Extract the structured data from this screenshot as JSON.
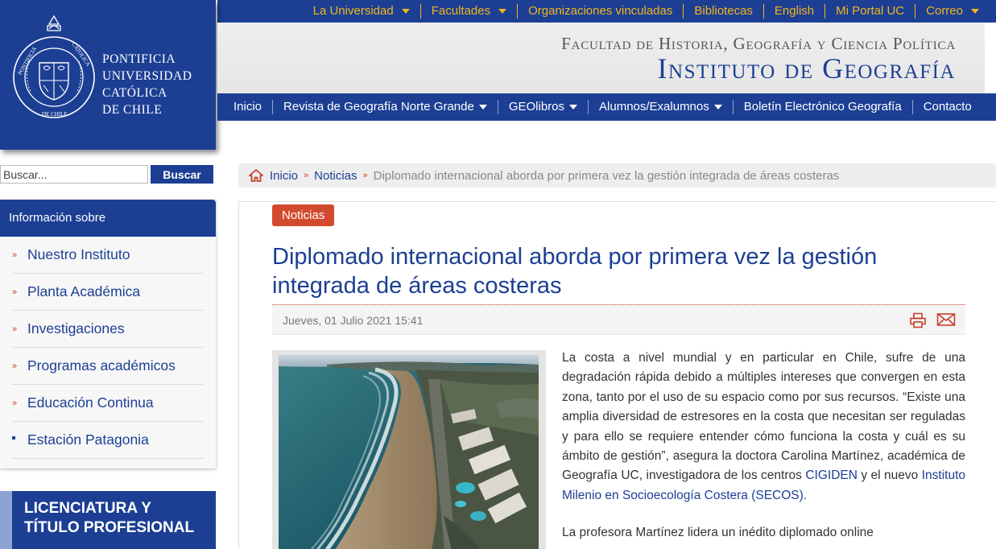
{
  "top_nav": [
    {
      "label": "La Universidad",
      "dropdown": true
    },
    {
      "label": "Facultades",
      "dropdown": true
    },
    {
      "label": "Organizaciones vinculadas",
      "dropdown": false
    },
    {
      "label": "Bibliotecas",
      "dropdown": false
    },
    {
      "label": "English",
      "dropdown": false
    },
    {
      "label": "Mi Portal UC",
      "dropdown": false
    },
    {
      "label": "Correo",
      "dropdown": true
    }
  ],
  "logo": {
    "line1": "PONTIFICIA",
    "line2": "UNIVERSIDAD",
    "line3": "CATÓLICA",
    "line4": "DE CHILE",
    "seal_ring_text": "PONTIFICIA UNIVERSIDAD CATÓLICA DE CHILE"
  },
  "banner": {
    "subtitle": "Facultad de Historia, Geografía y Ciencia Política",
    "title": "Instituto de Geografía"
  },
  "main_nav": [
    {
      "label": "Inicio",
      "dropdown": false
    },
    {
      "label": "Revista de Geografía Norte Grande",
      "dropdown": true
    },
    {
      "label": "GEOlibros",
      "dropdown": true
    },
    {
      "label": "Alumnos/Exalumnos",
      "dropdown": true
    },
    {
      "label": "Boletín Electrónico Geografía",
      "dropdown": false
    },
    {
      "label": "Contacto",
      "dropdown": false
    }
  ],
  "search": {
    "placeholder": "Buscar...",
    "button": "Buscar"
  },
  "sidebar": {
    "heading": "Información sobre",
    "items": [
      {
        "label": "Nuestro Instituto",
        "marker": "»"
      },
      {
        "label": "Planta Académica",
        "marker": "»"
      },
      {
        "label": "Investigaciones",
        "marker": "»"
      },
      {
        "label": "Programas académicos",
        "marker": "»"
      },
      {
        "label": "Educación Continua",
        "marker": "»"
      },
      {
        "label": "Estación Patagonia",
        "marker": "square"
      }
    ]
  },
  "promo": {
    "line1": "LICENCIATURA Y",
    "line2": "TÍTULO PROFESIONAL"
  },
  "breadcrumb": {
    "home": "Inicio",
    "section": "Noticias",
    "separator": "»",
    "current": "Diplomado internacional aborda por primera vez la gestión integrada de áreas costeras"
  },
  "article": {
    "category": "Noticias",
    "title": "Diplomado internacional aborda por primera vez la gestión integrada de áreas costeras",
    "date": "Jueves, 01 Julio 2021 15:41",
    "body_p1_a": "La costa a nivel mundial y en particular en Chile, sufre de una degradación rápida debido a múltiples intereses que convergen en esta zona, tanto por el uso de su espacio como por sus recursos. “Existe una amplia diversidad de estresores en la costa que necesitan ser reguladas y para ello se requiere entender cómo funciona la costa y cuál es su ámbito de gestión”, asegura la doctora Carolina Martínez, académica de Geografía UC,  investigadora de los centros ",
    "link1": "CIGIDEN",
    "body_p1_b": " y el nuevo ",
    "link2": "Instituto Milenio en Socioecología Costera (SECOS).",
    "body_p2": "La profesora Martínez lidera un inédito diplomado online"
  },
  "colors": {
    "brand": "#1c3f94",
    "accent": "#f2b61b",
    "tag": "#d24a2d"
  }
}
